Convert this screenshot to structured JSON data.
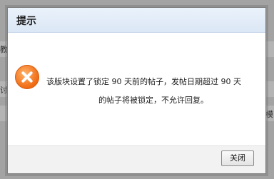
{
  "background": {
    "fragments": [
      {
        "text": "教"
      },
      {
        "text": "讨"
      },
      {
        "text": "模"
      }
    ]
  },
  "dialog": {
    "title": "提示",
    "icon": "error-icon",
    "message": {
      "line1": "该版块设置了锁定 90 天前的帖子，发帖日期超过 90 天",
      "line2": "的帖子将被锁定，不允许回复。"
    },
    "close_label": "关闭"
  }
}
